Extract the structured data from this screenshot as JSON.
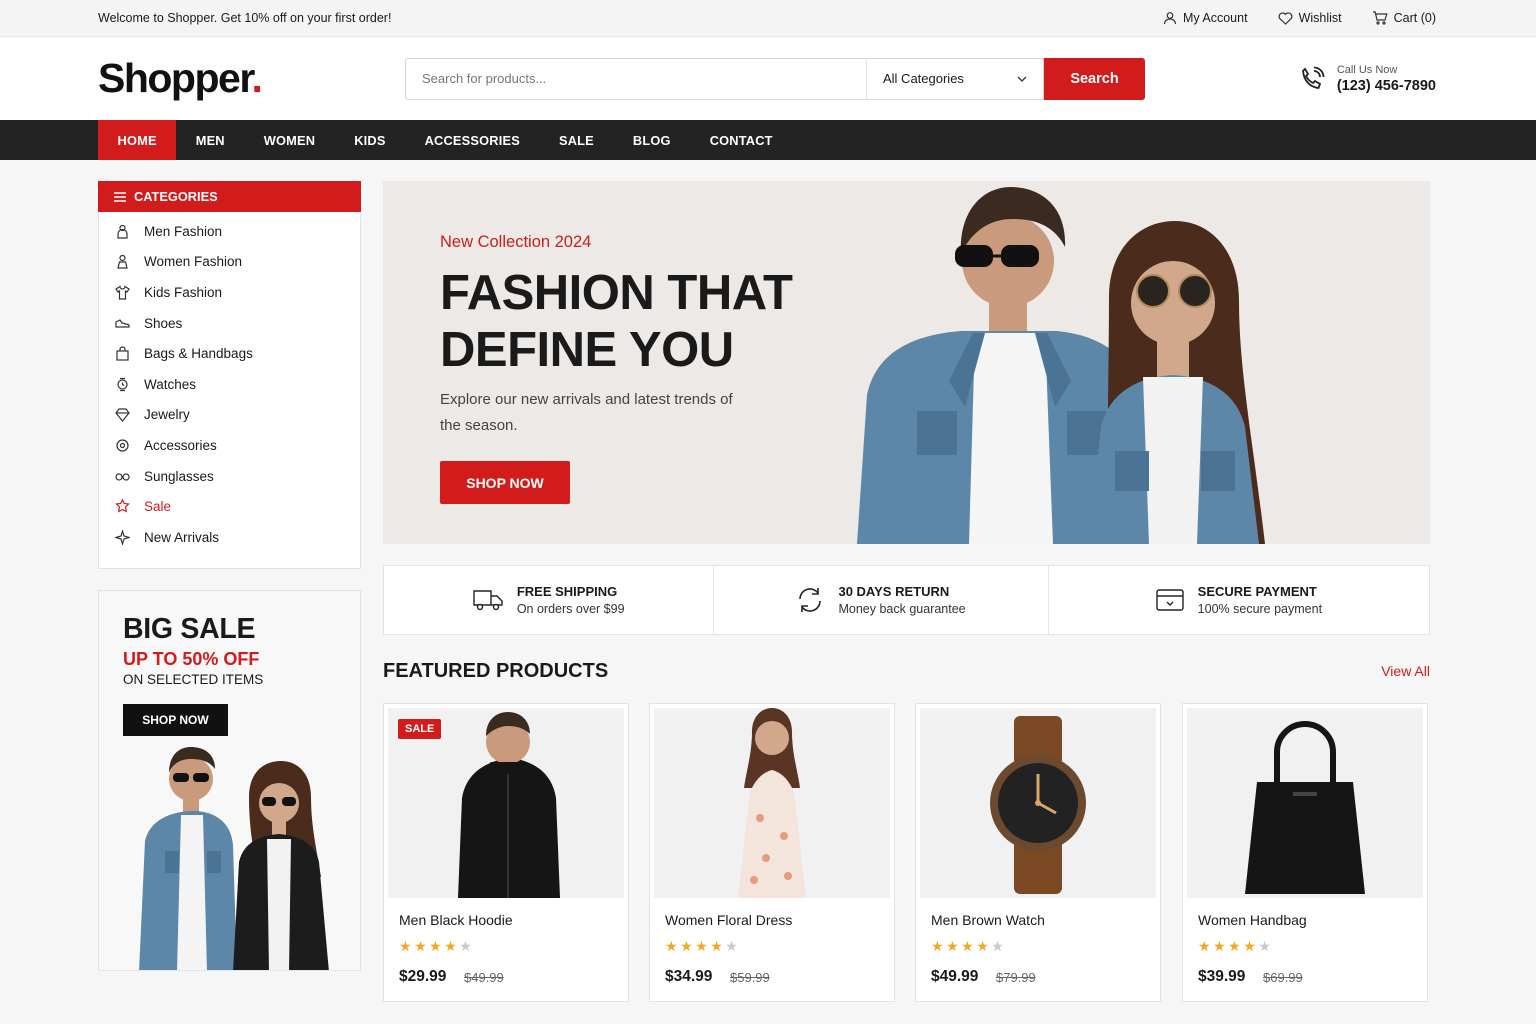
{
  "topbar": {
    "welcome": "Welcome to Shopper. Get 10% off on your first order!",
    "account_label": "My Account",
    "wishlist_label": "Wishlist",
    "cart_label": "Cart (0)"
  },
  "header": {
    "logo": "Shopper",
    "logo_dot": ".",
    "search_placeholder": "Search for products...",
    "category_select": "All Categories",
    "search_button": "Search",
    "call_label": "Call Us Now",
    "call_number": "(123) 456-7890"
  },
  "nav": {
    "items": [
      "HOME",
      "MEN",
      "WOMEN",
      "KIDS",
      "ACCESSORIES",
      "SALE",
      "BLOG",
      "CONTACT"
    ],
    "active": "HOME"
  },
  "sidebar": {
    "title": "CATEGORIES",
    "items": [
      {
        "label": "Men Fashion",
        "icon": "person-icon"
      },
      {
        "label": "Women Fashion",
        "icon": "person-icon"
      },
      {
        "label": "Kids Fashion",
        "icon": "shirt-icon"
      },
      {
        "label": "Shoes",
        "icon": "shoe-icon"
      },
      {
        "label": "Bags & Handbags",
        "icon": "bag-icon"
      },
      {
        "label": "Watches",
        "icon": "watch-icon"
      },
      {
        "label": "Jewelry",
        "icon": "gem-icon"
      },
      {
        "label": "Accessories",
        "icon": "badge-icon"
      },
      {
        "label": "Sunglasses",
        "icon": "glasses-icon"
      },
      {
        "label": "Sale",
        "icon": "tag-icon",
        "highlight": true
      },
      {
        "label": "New Arrivals",
        "icon": "sparkle-icon"
      }
    ]
  },
  "promo": {
    "title": "BIG SALE",
    "subtitle": "UP TO 50% OFF",
    "subtitle2": "ON SELECTED ITEMS",
    "button": "SHOP NOW"
  },
  "hero": {
    "eyebrow": "New Collection 2024",
    "title_line1": "FASHION THAT",
    "title_line2": "DEFINE YOU",
    "description": "Explore our new arrivals and latest trends of the season.",
    "button": "SHOP NOW"
  },
  "features": [
    {
      "title": "FREE SHIPPING",
      "subtitle": "On orders over $99",
      "icon": "truck-icon"
    },
    {
      "title": "30 DAYS RETURN",
      "subtitle": "Money back guarantee",
      "icon": "return-icon"
    },
    {
      "title": "SECURE PAYMENT",
      "subtitle": "100% secure payment",
      "icon": "payment-icon"
    }
  ],
  "featured": {
    "title": "FEATURED PRODUCTS",
    "view_all": "View All",
    "products": [
      {
        "name": "Men Black Hoodie",
        "price": "$29.99",
        "old_price": "$49.99",
        "rating": 4,
        "badge": "SALE"
      },
      {
        "name": "Women Floral Dress",
        "price": "$34.99",
        "old_price": "$59.99",
        "rating": 4,
        "badge": ""
      },
      {
        "name": "Men Brown Watch",
        "price": "$49.99",
        "old_price": "$79.99",
        "rating": 4,
        "badge": ""
      },
      {
        "name": "Women Handbag",
        "price": "$39.99",
        "old_price": "$69.99",
        "rating": 4,
        "badge": ""
      }
    ]
  },
  "colors": {
    "accent": "#d21c1c",
    "nav_bg": "#232323",
    "star": "#f5a623"
  }
}
